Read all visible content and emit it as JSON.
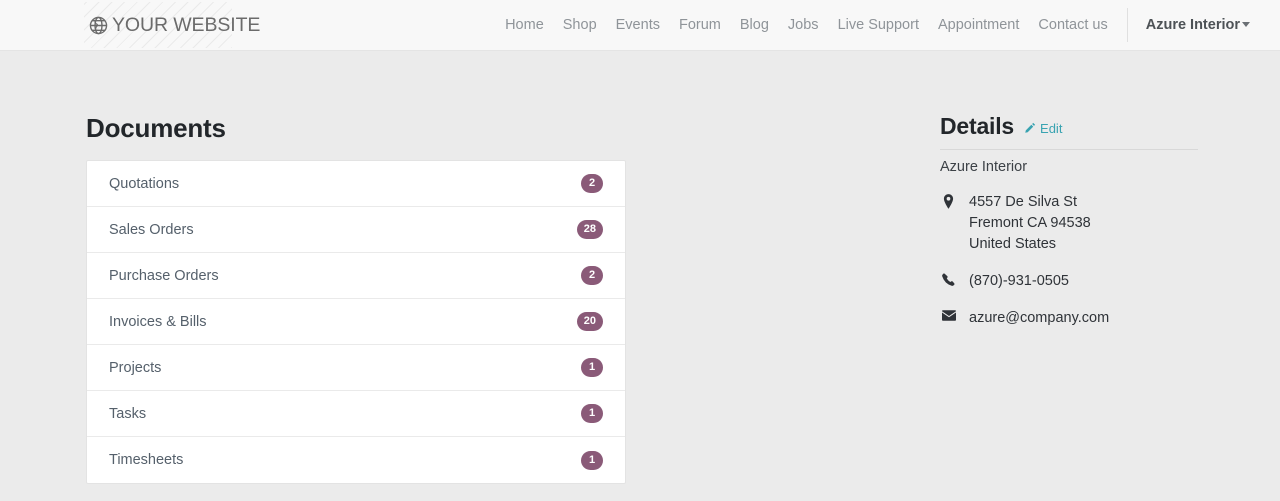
{
  "header": {
    "brand": {
      "text": "YOUR WEBSITE",
      "icon": "globe-icon"
    },
    "nav": [
      {
        "label": "Home"
      },
      {
        "label": "Shop"
      },
      {
        "label": "Events"
      },
      {
        "label": "Forum"
      },
      {
        "label": "Blog"
      },
      {
        "label": "Jobs"
      },
      {
        "label": "Live Support"
      },
      {
        "label": "Appointment"
      },
      {
        "label": "Contact us"
      }
    ],
    "user_menu": {
      "label": "Azure Interior",
      "icon": "chevron-down-icon"
    }
  },
  "main": {
    "title": "Documents",
    "documents": [
      {
        "label": "Quotations",
        "count": "2"
      },
      {
        "label": "Sales Orders",
        "count": "28"
      },
      {
        "label": "Purchase Orders",
        "count": "2"
      },
      {
        "label": "Invoices & Bills",
        "count": "20"
      },
      {
        "label": "Projects",
        "count": "1"
      },
      {
        "label": "Tasks",
        "count": "1"
      },
      {
        "label": "Timesheets",
        "count": "1"
      }
    ]
  },
  "details": {
    "title": "Details",
    "edit_label": "Edit",
    "partner_name": "Azure Interior",
    "address": {
      "icon": "location-pin-icon",
      "line1": "4557 De Silva St",
      "line2": "Fremont CA 94538",
      "line3": "United States"
    },
    "phone": {
      "icon": "phone-icon",
      "value": "(870)-931-0505"
    },
    "email": {
      "icon": "envelope-icon",
      "value": "azure@company.com"
    }
  },
  "colors": {
    "badge": "#8a5a78",
    "edit_link": "#39a3b1",
    "page_background": "#ebebeb",
    "header_background": "#f8f8f8"
  }
}
